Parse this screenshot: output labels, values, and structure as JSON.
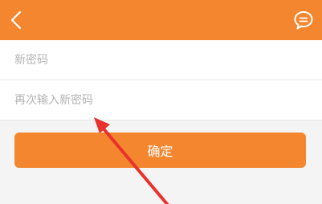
{
  "header": {
    "back_icon": "chevron-left-icon",
    "chat_icon": "message-bubble-icon",
    "background_color": "#f4862f"
  },
  "form": {
    "new_password": {
      "placeholder": "新密码",
      "value": ""
    },
    "confirm_password": {
      "placeholder": "再次输入新密码",
      "value": ""
    }
  },
  "actions": {
    "confirm_label": "确定",
    "button_color": "#f4862f"
  },
  "annotation": {
    "arrow_color": "#e8322b"
  }
}
